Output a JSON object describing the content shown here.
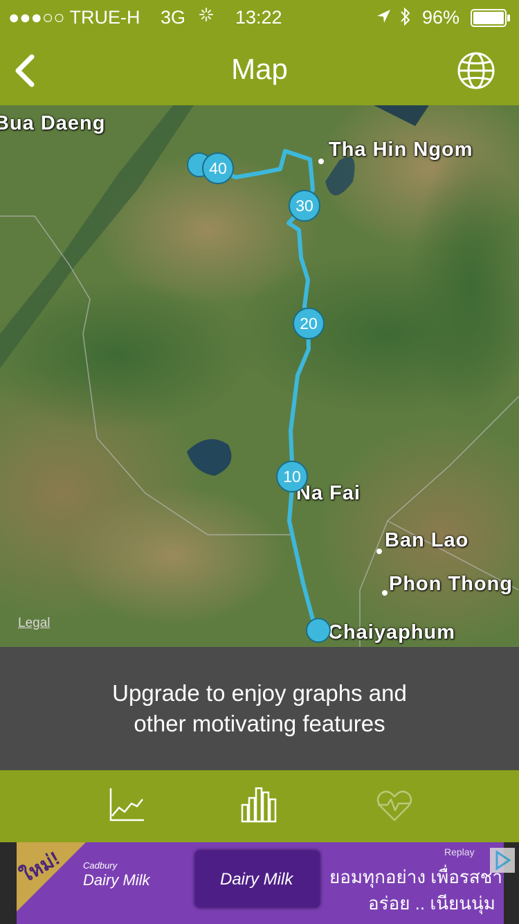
{
  "status_bar": {
    "carrier": "●●●○○ TRUE-H",
    "network": "3G",
    "time": "13:22",
    "battery": "96%"
  },
  "nav": {
    "title": "Map",
    "back_icon": "chevron-left-icon",
    "globe_icon": "globe-icon"
  },
  "map": {
    "places": [
      {
        "name": "Bua Daeng"
      },
      {
        "name": "Tha Hin Ngom"
      },
      {
        "name": "Na Fai"
      },
      {
        "name": "Ban Lao"
      },
      {
        "name": "Phon Thong"
      },
      {
        "name": "Chaiyaphum"
      }
    ],
    "markers": [
      "40",
      "30",
      "20",
      "10"
    ],
    "legal": "Legal",
    "route_color": "#3db8dc"
  },
  "upgrade": {
    "line1": "Upgrade to enjoy graphs and",
    "line2": "other motivating features"
  },
  "tabs": [
    {
      "icon": "line-chart-icon"
    },
    {
      "icon": "bar-chart-icon"
    },
    {
      "icon": "heart-rate-icon"
    }
  ],
  "ad": {
    "badge": "ใหม่!",
    "brand": "Dairy Milk",
    "brand_small": "Cadbury",
    "line1": "ยอมทุกอย่าง เพื่อรสชาติ",
    "line2": "อร่อย .. เนียนนุ่ม",
    "replay": "Replay"
  }
}
